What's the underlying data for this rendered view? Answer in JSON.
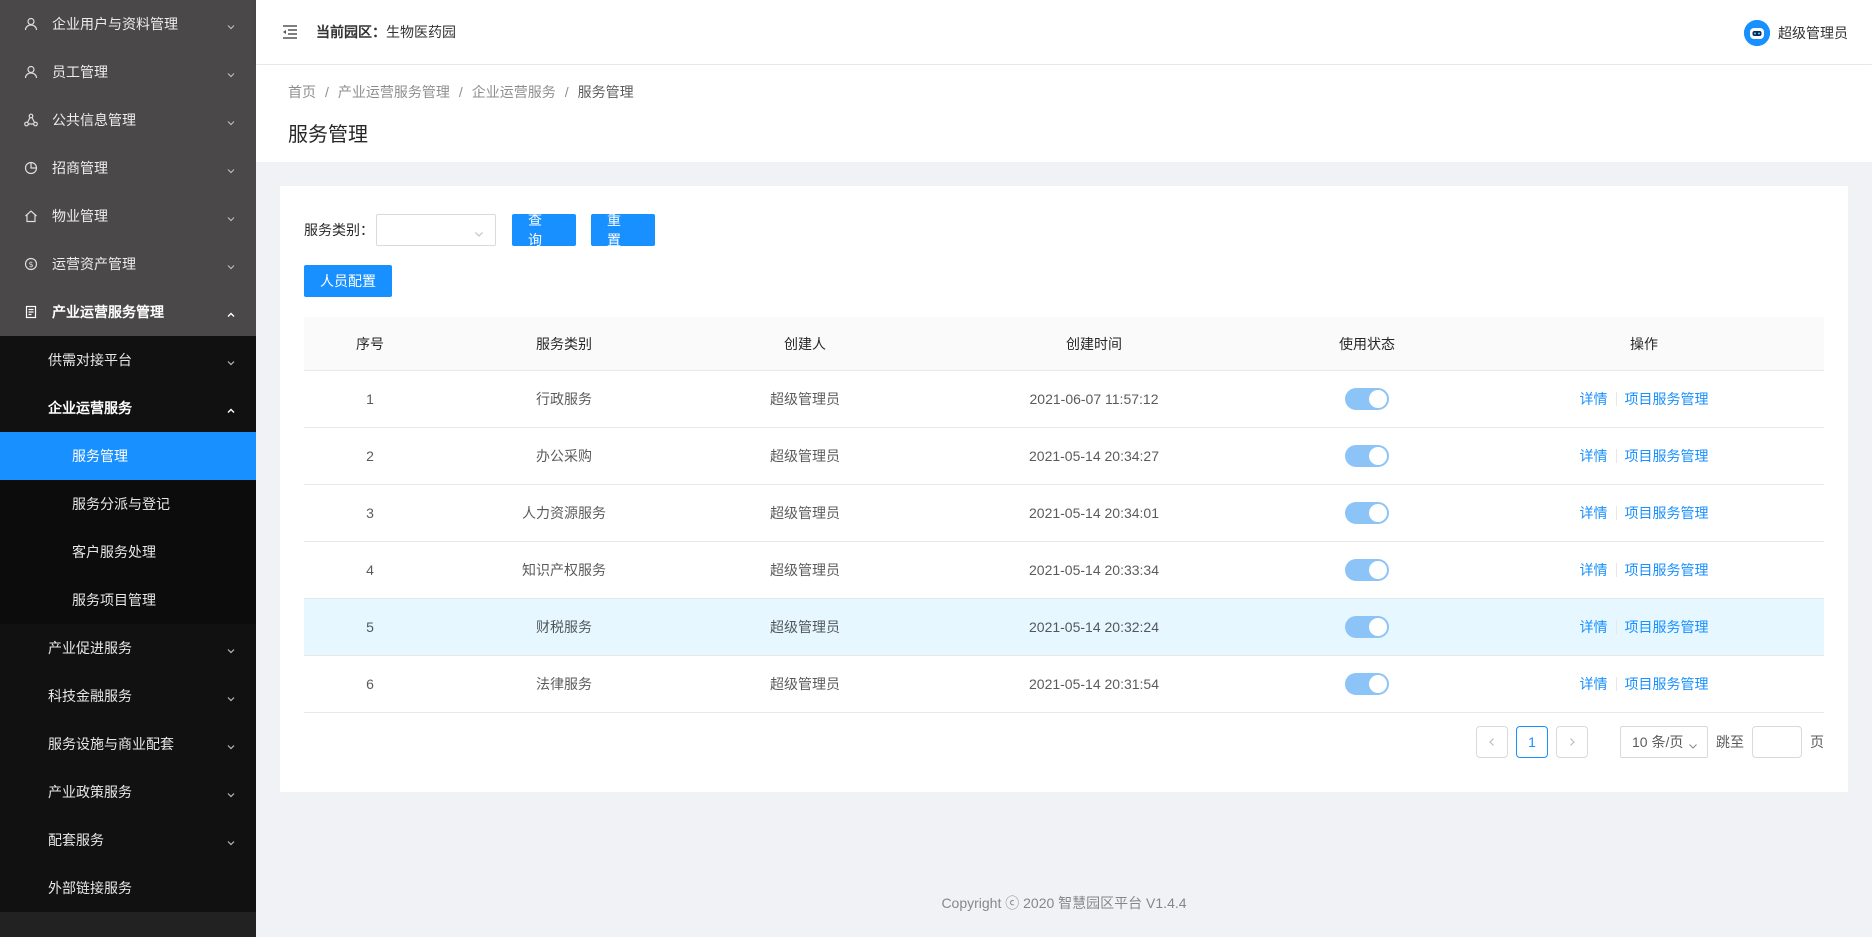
{
  "sidebar": {
    "top_items": [
      {
        "label": "企业用户与资料管理",
        "icon": "user-icon"
      },
      {
        "label": "员工管理",
        "icon": "user-icon"
      },
      {
        "label": "公共信息管理",
        "icon": "share-icon"
      },
      {
        "label": "招商管理",
        "icon": "pie-chart-icon"
      },
      {
        "label": "物业管理",
        "icon": "home-icon"
      },
      {
        "label": "运营资产管理",
        "icon": "dollar-icon"
      }
    ],
    "open_item": {
      "label": "产业运营服务管理",
      "icon": "doc-icon"
    },
    "sub_items": [
      {
        "label": "供需对接平台"
      },
      {
        "label": "企业运营服务"
      }
    ],
    "sub_sub_items": [
      {
        "label": "服务管理"
      },
      {
        "label": "服务分派与登记"
      },
      {
        "label": "客户服务处理"
      },
      {
        "label": "服务项目管理"
      }
    ],
    "bottom_sub_items": [
      {
        "label": "产业促进服务"
      },
      {
        "label": "科技金融服务"
      },
      {
        "label": "服务设施与商业配套"
      },
      {
        "label": "产业政策服务"
      },
      {
        "label": "配套服务"
      },
      {
        "label": "外部链接服务"
      }
    ]
  },
  "header": {
    "park_label": "当前园区：",
    "park_value": "生物医药园",
    "user_name": "超级管理员"
  },
  "breadcrumb": [
    "首页",
    "产业运营服务管理",
    "企业运营服务",
    "服务管理"
  ],
  "page_title": "服务管理",
  "filter": {
    "label": "服务类别：",
    "query_button": "查询",
    "reset_button": "重置",
    "staff_button": "人员配置"
  },
  "table": {
    "columns": [
      "序号",
      "服务类别",
      "创建人",
      "创建时间",
      "使用状态",
      "操作"
    ],
    "rows": [
      {
        "no": "1",
        "category": "行政服务",
        "creator": "超级管理员",
        "time": "2021-06-07 11:57:12",
        "enabled": true
      },
      {
        "no": "2",
        "category": "办公采购",
        "creator": "超级管理员",
        "time": "2021-05-14 20:34:27",
        "enabled": true
      },
      {
        "no": "3",
        "category": "人力资源服务",
        "creator": "超级管理员",
        "time": "2021-05-14 20:34:01",
        "enabled": true
      },
      {
        "no": "4",
        "category": "知识产权服务",
        "creator": "超级管理员",
        "time": "2021-05-14 20:33:34",
        "enabled": true
      },
      {
        "no": "5",
        "category": "财税服务",
        "creator": "超级管理员",
        "time": "2021-05-14 20:32:24",
        "enabled": true
      },
      {
        "no": "6",
        "category": "法律服务",
        "creator": "超级管理员",
        "time": "2021-05-14 20:31:54",
        "enabled": true
      }
    ],
    "action_detail": "详情",
    "action_manage": "项目服务管理"
  },
  "pagination": {
    "current_page": "1",
    "page_size": "10 条/页",
    "jump_label": "跳至",
    "page_label": "页"
  },
  "footer": "Copyright ⓒ 2020 智慧园区平台 V1.4.4",
  "colors": {
    "primary": "#1890ff",
    "sidebar_bg": "#222222",
    "sidebar_top_bg": "#4a4848"
  }
}
